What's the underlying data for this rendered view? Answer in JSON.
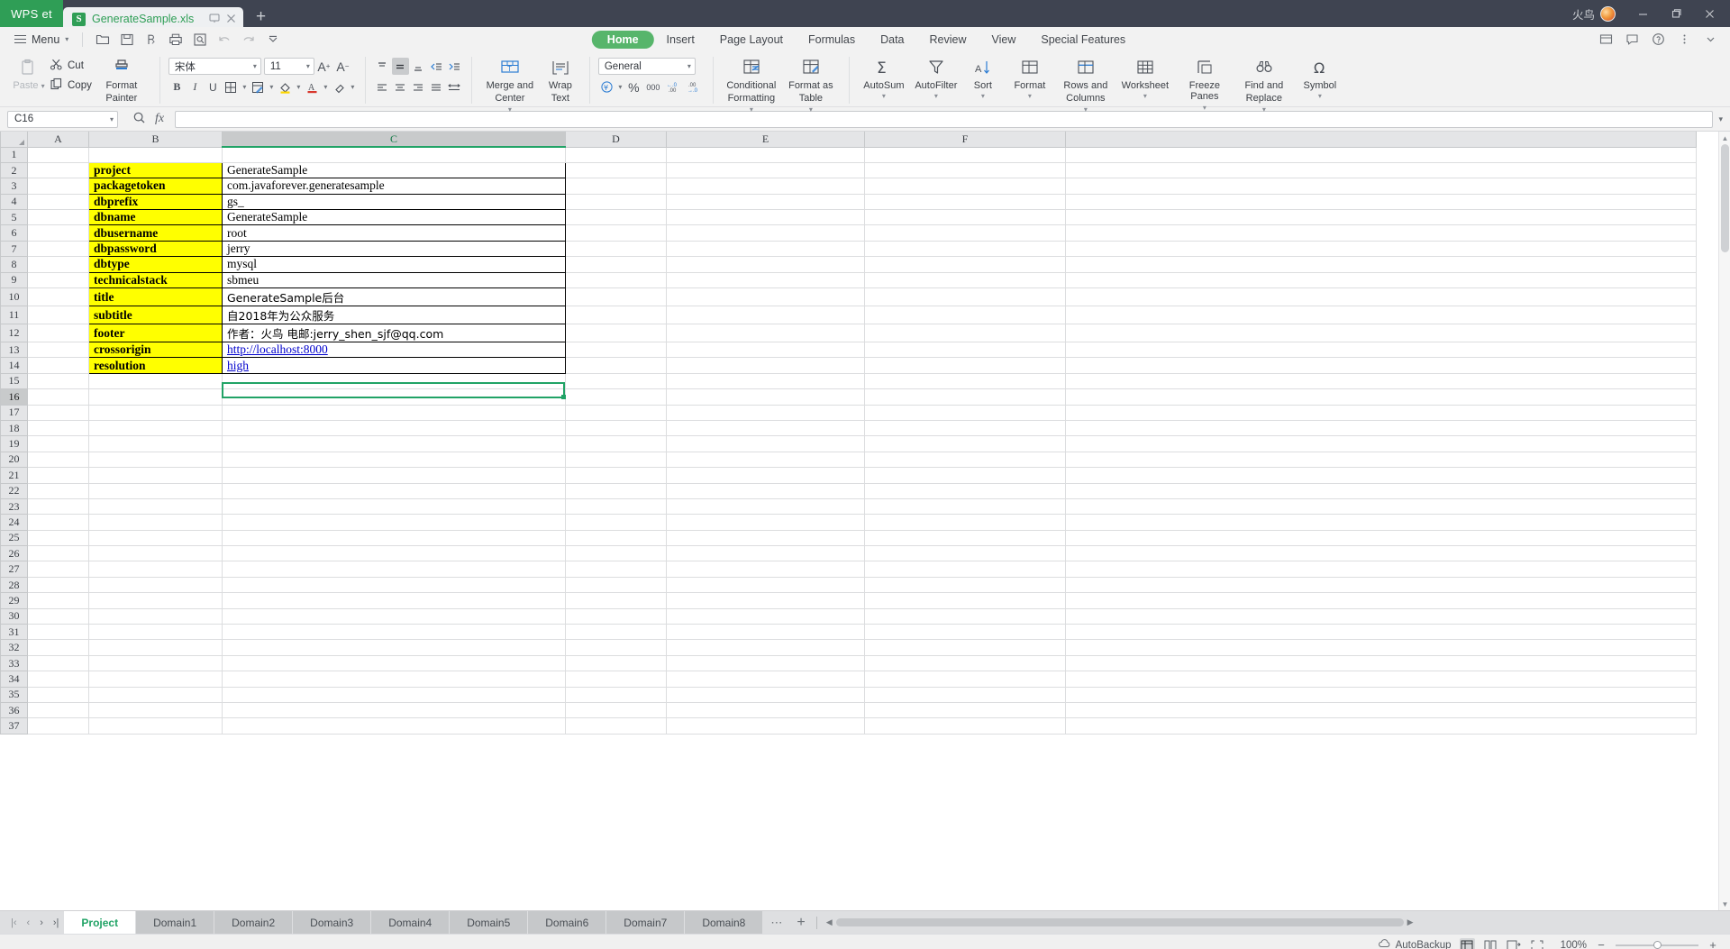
{
  "window": {
    "app_badge": "WPS et",
    "document_tab": "GenerateSample.xls",
    "user_name": "火鸟",
    "minimize": "—",
    "restore": "❐",
    "close": "✕",
    "new_tab": "+"
  },
  "quick_access": {
    "menu_label": "Menu",
    "icons": [
      "open-icon",
      "save-icon",
      "output-pdf-icon",
      "print-icon",
      "print-preview-icon",
      "undo-icon",
      "redo-icon",
      "customize-icon"
    ]
  },
  "ribbon_tabs": [
    {
      "label": "Home",
      "active": true
    },
    {
      "label": "Insert",
      "active": false
    },
    {
      "label": "Page Layout",
      "active": false
    },
    {
      "label": "Formulas",
      "active": false
    },
    {
      "label": "Data",
      "active": false
    },
    {
      "label": "Review",
      "active": false
    },
    {
      "label": "View",
      "active": false
    },
    {
      "label": "Special Features",
      "active": false
    }
  ],
  "ribbon": {
    "paste": "Paste",
    "cut": "Cut",
    "copy": "Copy",
    "format_painter_line1": "Format",
    "format_painter_line2": "Painter",
    "font_name": "宋体",
    "font_size": "11",
    "merge_center_line1": "Merge and",
    "merge_center_line2": "Center",
    "wrap_line1": "Wrap",
    "wrap_line2": "Text",
    "number_format": "General",
    "conditional_line1": "Conditional",
    "conditional_line2": "Formatting",
    "format_table_line1": "Format as",
    "format_table_line2": "Table",
    "autosum": "AutoSum",
    "autofilter": "AutoFilter",
    "sort": "Sort",
    "format": "Format",
    "rows_cols_line1": "Rows and",
    "rows_cols_line2": "Columns",
    "worksheet": "Worksheet",
    "freeze_panes": "Freeze Panes",
    "find_line1": "Find and",
    "find_line2": "Replace",
    "symbol": "Symbol"
  },
  "formula_bar": {
    "name_box": "C16",
    "formula_value": "",
    "formula_placeholder": ""
  },
  "grid": {
    "columns": [
      "A",
      "B",
      "C",
      "D",
      "E",
      "F"
    ],
    "selected_column": "C",
    "selected_row": 16,
    "rows": [
      {
        "n": 1,
        "b": "",
        "c": "",
        "filled": false
      },
      {
        "n": 2,
        "b": "project",
        "c": "GenerateSample",
        "filled": true
      },
      {
        "n": 3,
        "b": "packagetoken",
        "c": "com.javaforever.generatesample",
        "filled": true
      },
      {
        "n": 4,
        "b": "dbprefix",
        "c": "gs_",
        "filled": true
      },
      {
        "n": 5,
        "b": "dbname",
        "c": "GenerateSample",
        "filled": true
      },
      {
        "n": 6,
        "b": "dbusername",
        "c": "root",
        "filled": true
      },
      {
        "n": 7,
        "b": "dbpassword",
        "c": "jerry",
        "filled": true
      },
      {
        "n": 8,
        "b": "dbtype",
        "c": "mysql",
        "filled": true
      },
      {
        "n": 9,
        "b": "technicalstack",
        "c": "sbmeu",
        "filled": true
      },
      {
        "n": 10,
        "b": "title",
        "c": "GenerateSample后台",
        "filled": true,
        "cjk": true
      },
      {
        "n": 11,
        "b": "subtitle",
        "c": "自2018年为公众服务",
        "filled": true,
        "cjk": true
      },
      {
        "n": 12,
        "b": "footer",
        "c": "作者：火鸟 电邮:jerry_shen_sjf@qq.com",
        "filled": true,
        "cjk": true
      },
      {
        "n": 13,
        "b": "crossorigin",
        "c": "http://localhost:8000",
        "filled": true,
        "link": true
      },
      {
        "n": 14,
        "b": "resolution",
        "c": "high",
        "filled": true,
        "link": true
      },
      {
        "n": 15,
        "b": "",
        "c": "",
        "filled": false
      },
      {
        "n": 16,
        "b": "",
        "c": "",
        "filled": false
      },
      {
        "n": 17,
        "b": "",
        "c": "",
        "filled": false
      },
      {
        "n": 18,
        "b": "",
        "c": "",
        "filled": false
      },
      {
        "n": 19,
        "b": "",
        "c": "",
        "filled": false
      },
      {
        "n": 20,
        "b": "",
        "c": "",
        "filled": false
      },
      {
        "n": 21,
        "b": "",
        "c": "",
        "filled": false
      },
      {
        "n": 22,
        "b": "",
        "c": "",
        "filled": false
      },
      {
        "n": 23,
        "b": "",
        "c": "",
        "filled": false
      },
      {
        "n": 24,
        "b": "",
        "c": "",
        "filled": false
      },
      {
        "n": 25,
        "b": "",
        "c": "",
        "filled": false
      },
      {
        "n": 26,
        "b": "",
        "c": "",
        "filled": false
      },
      {
        "n": 27,
        "b": "",
        "c": "",
        "filled": false
      },
      {
        "n": 28,
        "b": "",
        "c": "",
        "filled": false
      },
      {
        "n": 29,
        "b": "",
        "c": "",
        "filled": false
      },
      {
        "n": 30,
        "b": "",
        "c": "",
        "filled": false
      },
      {
        "n": 31,
        "b": "",
        "c": "",
        "filled": false
      },
      {
        "n": 32,
        "b": "",
        "c": "",
        "filled": false
      },
      {
        "n": 33,
        "b": "",
        "c": "",
        "filled": false
      },
      {
        "n": 34,
        "b": "",
        "c": "",
        "filled": false
      },
      {
        "n": 35,
        "b": "",
        "c": "",
        "filled": false
      },
      {
        "n": 36,
        "b": "",
        "c": "",
        "filled": false
      },
      {
        "n": 37,
        "b": "",
        "c": "",
        "filled": false
      }
    ]
  },
  "sheet_tabs": {
    "items": [
      {
        "label": "Project",
        "active": true
      },
      {
        "label": "Domain1",
        "active": false
      },
      {
        "label": "Domain2",
        "active": false
      },
      {
        "label": "Domain3",
        "active": false
      },
      {
        "label": "Domain4",
        "active": false
      },
      {
        "label": "Domain5",
        "active": false
      },
      {
        "label": "Domain6",
        "active": false
      },
      {
        "label": "Domain7",
        "active": false
      },
      {
        "label": "Domain8",
        "active": false
      }
    ],
    "overflow": "⋯",
    "add": "+"
  },
  "status_bar": {
    "autobackup": "AutoBackup",
    "zoom": "100%",
    "zoom_out": "−",
    "zoom_in": "+"
  },
  "colors": {
    "brand_green": "#2f9e56",
    "tab_active_green": "#57b56b",
    "selection_green": "#21a366",
    "highlight_yellow": "#ffff00",
    "link_blue": "#0000cc",
    "titlebar": "#3f4451"
  }
}
